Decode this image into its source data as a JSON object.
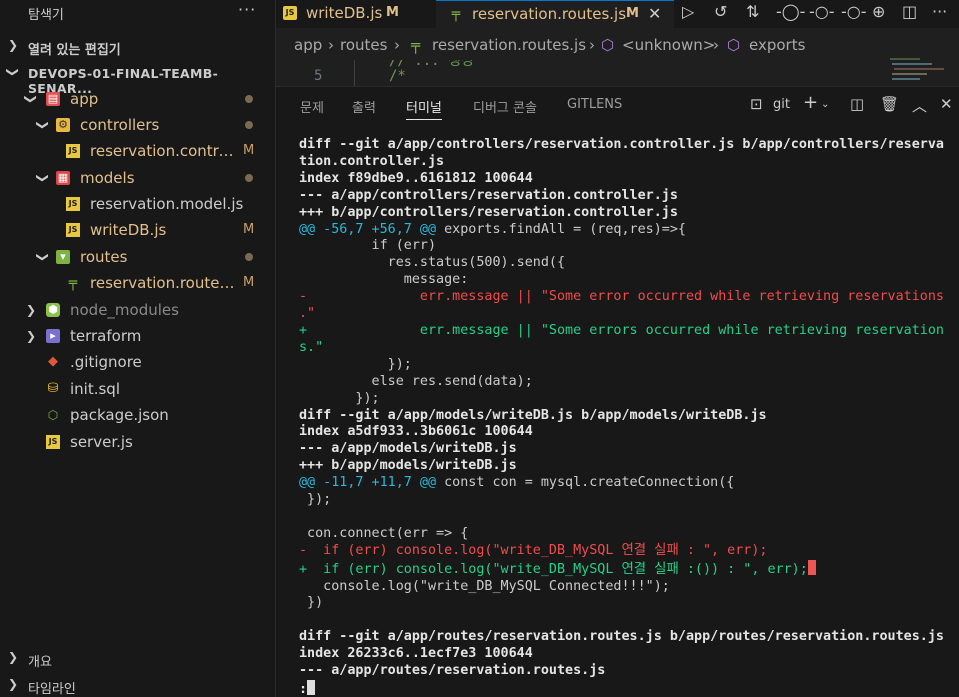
{
  "sidebar": {
    "title": "탐색기",
    "more": "···",
    "open_editors": "열려 있는 편집기",
    "project": "DEVOPS-01-FINAL-TEAMB-SENAR...",
    "tree": [
      {
        "label": "app",
        "status": "dot"
      },
      {
        "label": "controllers",
        "status": "dot"
      },
      {
        "label": "reservation.contro...",
        "status": "M"
      },
      {
        "label": "models",
        "status": "dot"
      },
      {
        "label": "reservation.model.js",
        "status": ""
      },
      {
        "label": "writeDB.js",
        "status": "M"
      },
      {
        "label": "routes",
        "status": "dot"
      },
      {
        "label": "reservation.routes...",
        "status": "M"
      },
      {
        "label": "node_modules",
        "status": ""
      },
      {
        "label": "terraform",
        "status": ""
      },
      {
        "label": ".gitignore",
        "status": ""
      },
      {
        "label": "init.sql",
        "status": ""
      },
      {
        "label": "package.json",
        "status": ""
      },
      {
        "label": "server.js",
        "status": ""
      }
    ],
    "outline": "개요",
    "timeline": "타임라인"
  },
  "tabs": [
    {
      "label": "writeDB.js",
      "mod": "M",
      "icon": "js-icon"
    },
    {
      "label": "reservation.routes.js",
      "mod": "M",
      "icon": "routes-icon",
      "close": "✕"
    }
  ],
  "breadcrumb": {
    "a": "app",
    "b": "routes",
    "c": "reservation.routes.js",
    "d": "<unknown>",
    "e": "exports",
    "sep": "›"
  },
  "editor_peek": {
    "line1_num": "5",
    "line1": "/*",
    "line0": "// ... 생성"
  },
  "panel": {
    "tabs": [
      "문제",
      "출력",
      "터미널",
      "디버그 콘솔",
      "GITLENS"
    ],
    "active": "터미널",
    "shell": "git"
  },
  "terminal": {
    "l1": "diff --git a/app/controllers/reservation.controller.js b/app/controllers/reserva",
    "l2": "tion.controller.js",
    "l3": "index f89dbe9..6161812 100644",
    "l4": "--- a/app/controllers/reservation.controller.js",
    "l5": "+++ b/app/controllers/reservation.controller.js",
    "l6a": "@@ -56,7 +56,7 @@",
    "l6b": " exports.findAll = (req,res)=>{",
    "l7": "         if (err)",
    "l8": "           res.status(500).send({",
    "l9": "             message:",
    "l10": "-              err.message || \"Some error occurred while retrieving reservations",
    "l11": ".\"",
    "l12": "+              err.message || \"Some errors occurred while retrieving reservation",
    "l13": "s.\"",
    "l14": "           });",
    "l15": "         else res.send(data);",
    "l16": "       });",
    "l17": "diff --git a/app/models/writeDB.js b/app/models/writeDB.js",
    "l18": "index a5df933..3b6061c 100644",
    "l19": "--- a/app/models/writeDB.js",
    "l20": "+++ b/app/models/writeDB.js",
    "l21a": "@@ -11,7 +11,7 @@",
    "l21b": " const con = mysql.createConnection({",
    "l22": " });",
    "l23": "",
    "l24": " con.connect(err => {",
    "l25": "-  if (err) console.log(\"write_DB_MySQL 연결 실패 : \", err);",
    "l26": "+  if (err) console.log(\"write_DB_MySQL 연결 실패 :()) : \", err);",
    "l27": "   console.log(\"write_DB_MySQL Connected!!!\");",
    "l28": " })",
    "l29": "",
    "l30": "diff --git a/app/routes/reservation.routes.js b/app/routes/reservation.routes.js",
    "l31": "index 26233c6..1ecf7e3 100644",
    "l32": "--- a/app/routes/reservation.routes.js",
    "l33": ":"
  },
  "colors": {
    "accent": "#e2c08d",
    "add": "#23d18b",
    "del": "#f14c4c",
    "hunk": "#29b8db"
  }
}
